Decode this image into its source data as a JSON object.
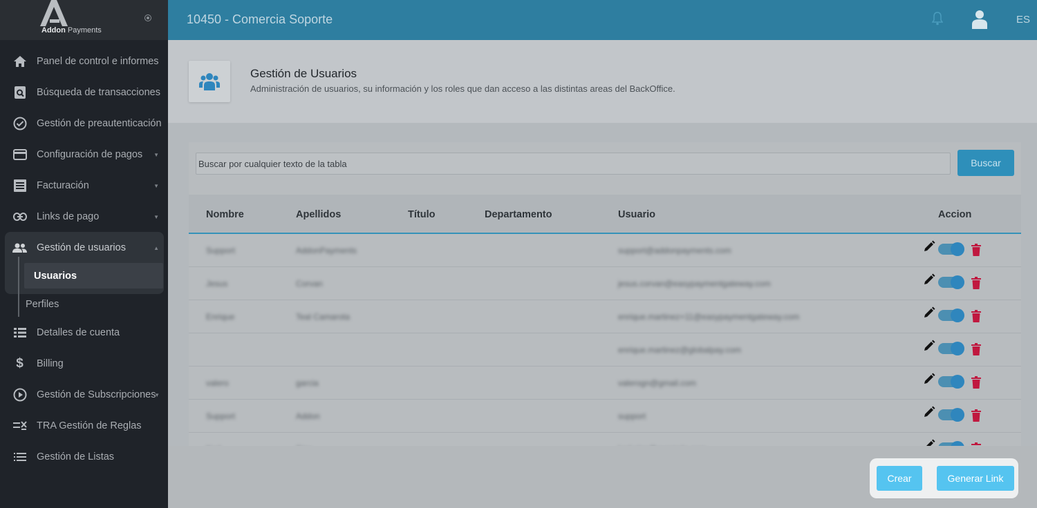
{
  "brand": {
    "name_bold": "Addon",
    "name_light": "Payments"
  },
  "topbar": {
    "title": "10450 - Comercia Soporte",
    "lang": "ES"
  },
  "sidebar": {
    "items": [
      {
        "label": "Panel de control e informes",
        "icon": "home-icon"
      },
      {
        "label": "Búsqueda de transacciones",
        "icon": "search-doc-icon"
      },
      {
        "label": "Gestión de preautenticación",
        "icon": "check-circle-icon"
      },
      {
        "label": "Configuración de pagos",
        "icon": "card-icon"
      },
      {
        "label": "Facturación",
        "icon": "invoice-icon"
      },
      {
        "label": "Links de pago",
        "icon": "link-icon"
      },
      {
        "label": "Gestión de usuarios",
        "icon": "users-icon"
      },
      {
        "label": "Detalles de cuenta",
        "icon": "list-grid-icon"
      },
      {
        "label": "Billing",
        "icon": "dollar-icon"
      },
      {
        "label": "Gestión de Subscripciones",
        "icon": "play-circle-icon"
      },
      {
        "label": "TRA Gestión de Reglas",
        "icon": "rules-icon"
      },
      {
        "label": "Gestión de Listas",
        "icon": "list-icon"
      }
    ],
    "sub_items": [
      {
        "label": "Usuarios"
      },
      {
        "label": "Perfiles"
      }
    ]
  },
  "header": {
    "title": "Gestión de Usuarios",
    "subtitle": "Administración de usuarios, su información y los roles que dan acceso a las distintas areas del BackOffice."
  },
  "search": {
    "placeholder": "Buscar por cualquier texto de la tabla",
    "button": "Buscar"
  },
  "table": {
    "columns": [
      "Nombre",
      "Apellidos",
      "Título",
      "Departamento",
      "Usuario",
      "Accion"
    ],
    "rows": [
      {
        "nombre": "Support",
        "apellidos": "AddonPayments",
        "usuario": "support@addonpayments.com"
      },
      {
        "nombre": "Jesus",
        "apellidos": "Corvan",
        "usuario": "jesus.corvan@easypaymentgateway.com"
      },
      {
        "nombre": "Enrique",
        "apellidos": "Teal Camarota",
        "usuario": "enrique.martinez+11@easypaymentgateway.com"
      },
      {
        "nombre": "",
        "apellidos": "",
        "usuario": "enrique.martinez@globalpay.com"
      },
      {
        "nombre": "valero",
        "apellidos": "garcia",
        "usuario": "valerogn@gmail.com"
      },
      {
        "nombre": "Support",
        "apellidos": "Addon",
        "usuario": "support"
      },
      {
        "nombre": "Karl",
        "apellidos": "Sizo",
        "usuario": "karl.sizo@example.com"
      }
    ]
  },
  "footer": {
    "crear": "Crear",
    "generar": "Generar Link"
  }
}
